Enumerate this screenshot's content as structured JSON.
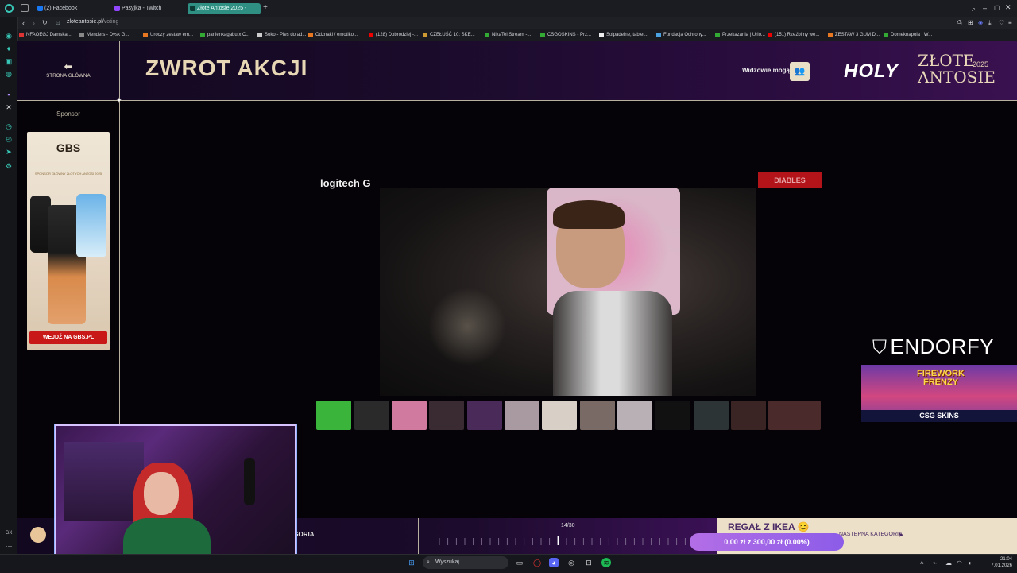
{
  "browser": {
    "tabs": [
      {
        "label": "(2) Facebook",
        "color": "#1877f2"
      },
      {
        "label": "Pasyjka - Twitch",
        "color": "#9146ff"
      },
      {
        "label": "Złote Antosie 2025 - ",
        "color": "#2f8f83",
        "active": true
      }
    ],
    "new_tab": "+",
    "url": "zloteantosie.pl/",
    "url_path": "voting",
    "bookmarks": [
      {
        "label": "NFAOEGJ Damska...",
        "color": "#d33"
      },
      {
        "label": "Menders - Dysk G...",
        "color": "#888"
      },
      {
        "label": "Uroczy zestaw em...",
        "color": "#e87722"
      },
      {
        "label": "panienkagabu x C...",
        "color": "#3a3"
      },
      {
        "label": "Soko - Pies do ad...",
        "color": "#ccc"
      },
      {
        "label": "Odznaki / emotiko...",
        "color": "#e87722"
      },
      {
        "label": "(128) Dobrodziej -...",
        "color": "#e00"
      },
      {
        "label": "CZEŁUŚĆ 10: SKE...",
        "color": "#c93"
      },
      {
        "label": "NikaTel Stream -...",
        "color": "#3a3"
      },
      {
        "label": "CSGOSKINS - Prz...",
        "color": "#3a3"
      },
      {
        "label": "Solpadeine, tablet...",
        "color": "#eee"
      },
      {
        "label": "Fundacja Ochrony...",
        "color": "#4aa3e0"
      },
      {
        "label": "Przekazania | Urlo...",
        "color": "#3a3"
      },
      {
        "label": "(151) Rzeźbimy we...",
        "color": "#e00"
      },
      {
        "label": "ZESTAW 3 GUM D...",
        "color": "#e87722"
      },
      {
        "label": "Domeknapola | W...",
        "color": "#3a3"
      }
    ]
  },
  "header": {
    "home_label": "STRONA GŁÓWNA",
    "page_title": "ZWROT AKCJI",
    "viewers_label": "Widzowie mogą",
    "logo_holy": "HOLY",
    "logo_zlote": "ZŁOTE",
    "logo_antosie": "ANTOSIE",
    "logo_year": "2025"
  },
  "sponsor": {
    "label": "Sponsor",
    "brand": "GBS",
    "tagline": "SPONSOR GŁÓWNY ZŁOTYCH ANTOSI 2025",
    "cta": "WEJDŹ NA GBS.PL"
  },
  "stream": {
    "logitech": "logitech G",
    "diables": "DIABLES"
  },
  "ads": {
    "endorfy": "ENDORFY",
    "game_title": "FIREWORK FRENZY",
    "csgo": "CSG SKINS"
  },
  "bottom": {
    "category_left": "EGORIA",
    "progress": "14/30",
    "progress_value": 14,
    "progress_total": 30,
    "card_title": "REGAŁ Z IKEA",
    "card_emoji": "😊",
    "next_category": "NASTĘPNA KATEGORIA",
    "raised": "0,00 zł z 300,00 zł (0.00%)"
  },
  "taskbar": {
    "search_placeholder": "Wyszukaj",
    "time": "21:04",
    "date": "7.01.2026"
  },
  "colors": {
    "accent_gold": "#e7d7b4",
    "accent_teal": "#2f8f83",
    "purple": "#3a1155"
  }
}
